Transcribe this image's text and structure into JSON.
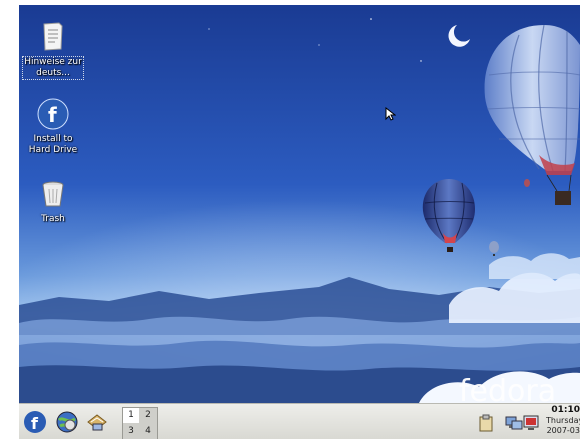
{
  "desktop": {
    "icons": [
      {
        "label": "Hinweise zur deuts...",
        "icon": "text-document-icon"
      },
      {
        "label": "Install to Hard Drive",
        "icon": "fedora-installer-icon"
      },
      {
        "label": "Trash",
        "icon": "trash-icon"
      }
    ],
    "wallpaper_brand": "fedora"
  },
  "panel": {
    "launchers": [
      "fedora-menu-icon",
      "web-browser-icon",
      "mail-client-icon"
    ],
    "workspaces": [
      "1",
      "2",
      "3",
      "4"
    ],
    "active_workspace": "1",
    "tray_icons": [
      "clipboard-icon",
      "network-icon",
      "display-icon"
    ],
    "clock": {
      "time": "01:10",
      "day": "Thursday",
      "date": "2007-03"
    }
  },
  "colors": {
    "sky_top": "#1f3f9a",
    "sky_mid": "#2b5fc4",
    "horizon": "#8fb6e6",
    "panel_bg": "#e4e4df"
  }
}
